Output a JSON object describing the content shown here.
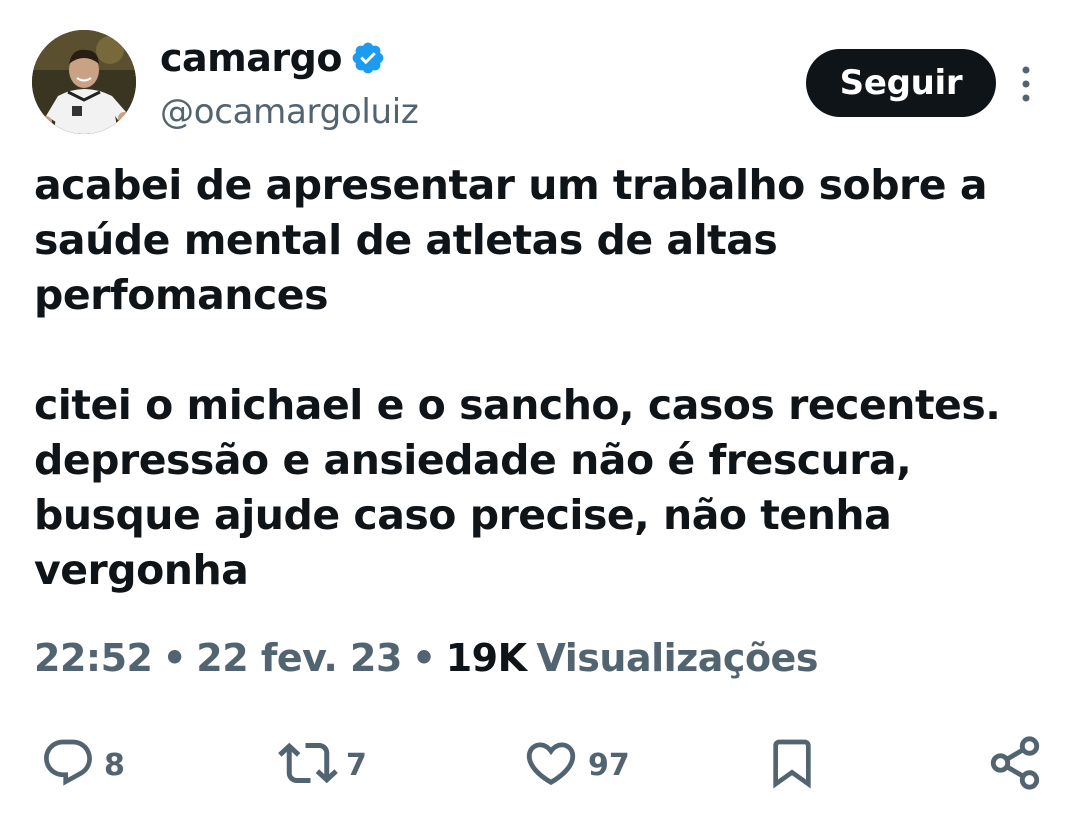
{
  "author": {
    "display_name": "camargo",
    "handle": "@ocamargoluiz",
    "verified": true,
    "avatar": "avatar"
  },
  "header": {
    "follow_label": "Seguir",
    "more_icon": "more-vertical-icon"
  },
  "tweet": {
    "paragraph_1": "acabei de apresentar um trabalho sobre a saúde mental de atletas de altas perfomances",
    "paragraph_2_line_1": "citei o michael e o sancho, casos recentes.",
    "paragraph_2_line_2": "depressão e ansiedade não é frescura, busque ajude caso precise, não tenha vergonha"
  },
  "meta": {
    "time": "22:52",
    "separator": "•",
    "date": "22 fev. 23",
    "views_count": "19K",
    "views_label": "Visualizações"
  },
  "actions": {
    "reply": {
      "icon": "reply-icon",
      "count": "8"
    },
    "retweet": {
      "icon": "retweet-icon",
      "count": "7"
    },
    "like": {
      "icon": "heart-icon",
      "count": "97"
    },
    "bookmark": {
      "icon": "bookmark-icon"
    },
    "share": {
      "icon": "share-icon"
    }
  },
  "colors": {
    "text_primary": "#0f1419",
    "text_secondary": "#536471",
    "verified_blue": "#1d9bf0",
    "button_bg": "#0f1419",
    "button_text": "#ffffff"
  }
}
